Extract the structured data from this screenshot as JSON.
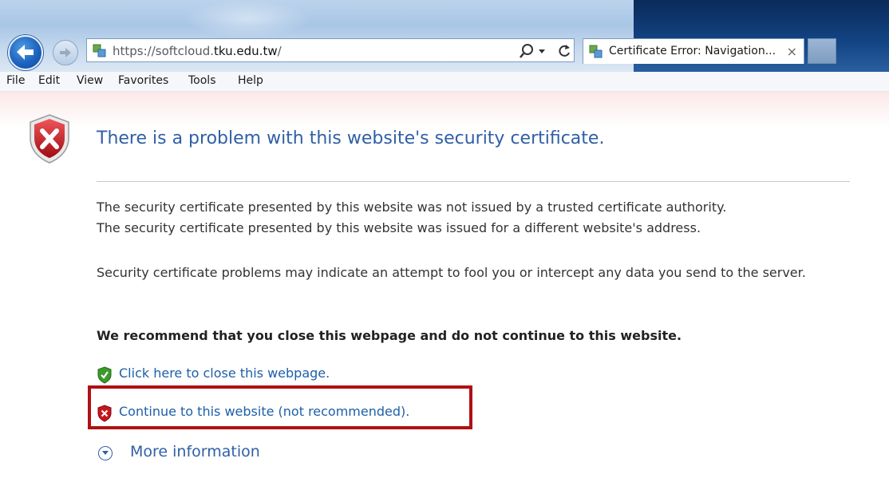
{
  "browser": {
    "url_prefix": "https://softcloud.",
    "url_domain": "tku.edu.tw",
    "url_suffix": "/",
    "tab_title": "Certificate Error: Navigation...",
    "tab_close": "×"
  },
  "menu": {
    "items": [
      "File",
      "Edit",
      "View",
      "Favorites",
      "Tools",
      "Help"
    ]
  },
  "page": {
    "heading": "There is a problem with this website's security certificate.",
    "para1_line1": "The security certificate presented by this website was not issued by a trusted certificate authority.",
    "para1_line2": "The security certificate presented by this website was issued for a different website's address.",
    "para2": "Security certificate problems may indicate an attempt to fool you or intercept any data you send to the server.",
    "recommend": "We recommend that you close this webpage and do not continue to this website.",
    "close_link": "Click here to close this webpage.",
    "continue_link": "Continue to this website (not recommended).",
    "more_info": "More information"
  },
  "colors": {
    "heading": "#2f5fa6",
    "link": "#1d5fa8",
    "highlight": "#b01014",
    "error_shield": "#c8161d",
    "ok_shield": "#3a9a2a"
  },
  "icons": {
    "back": "back-arrow-icon",
    "forward": "forward-arrow-icon",
    "site": "site-compatibility-icon",
    "search": "search-icon",
    "refresh": "refresh-icon",
    "big_shield": "error-shield-icon",
    "close_shield": "ok-shield-icon",
    "continue_shield": "error-shield-small-icon",
    "more": "expand-circle-icon"
  }
}
